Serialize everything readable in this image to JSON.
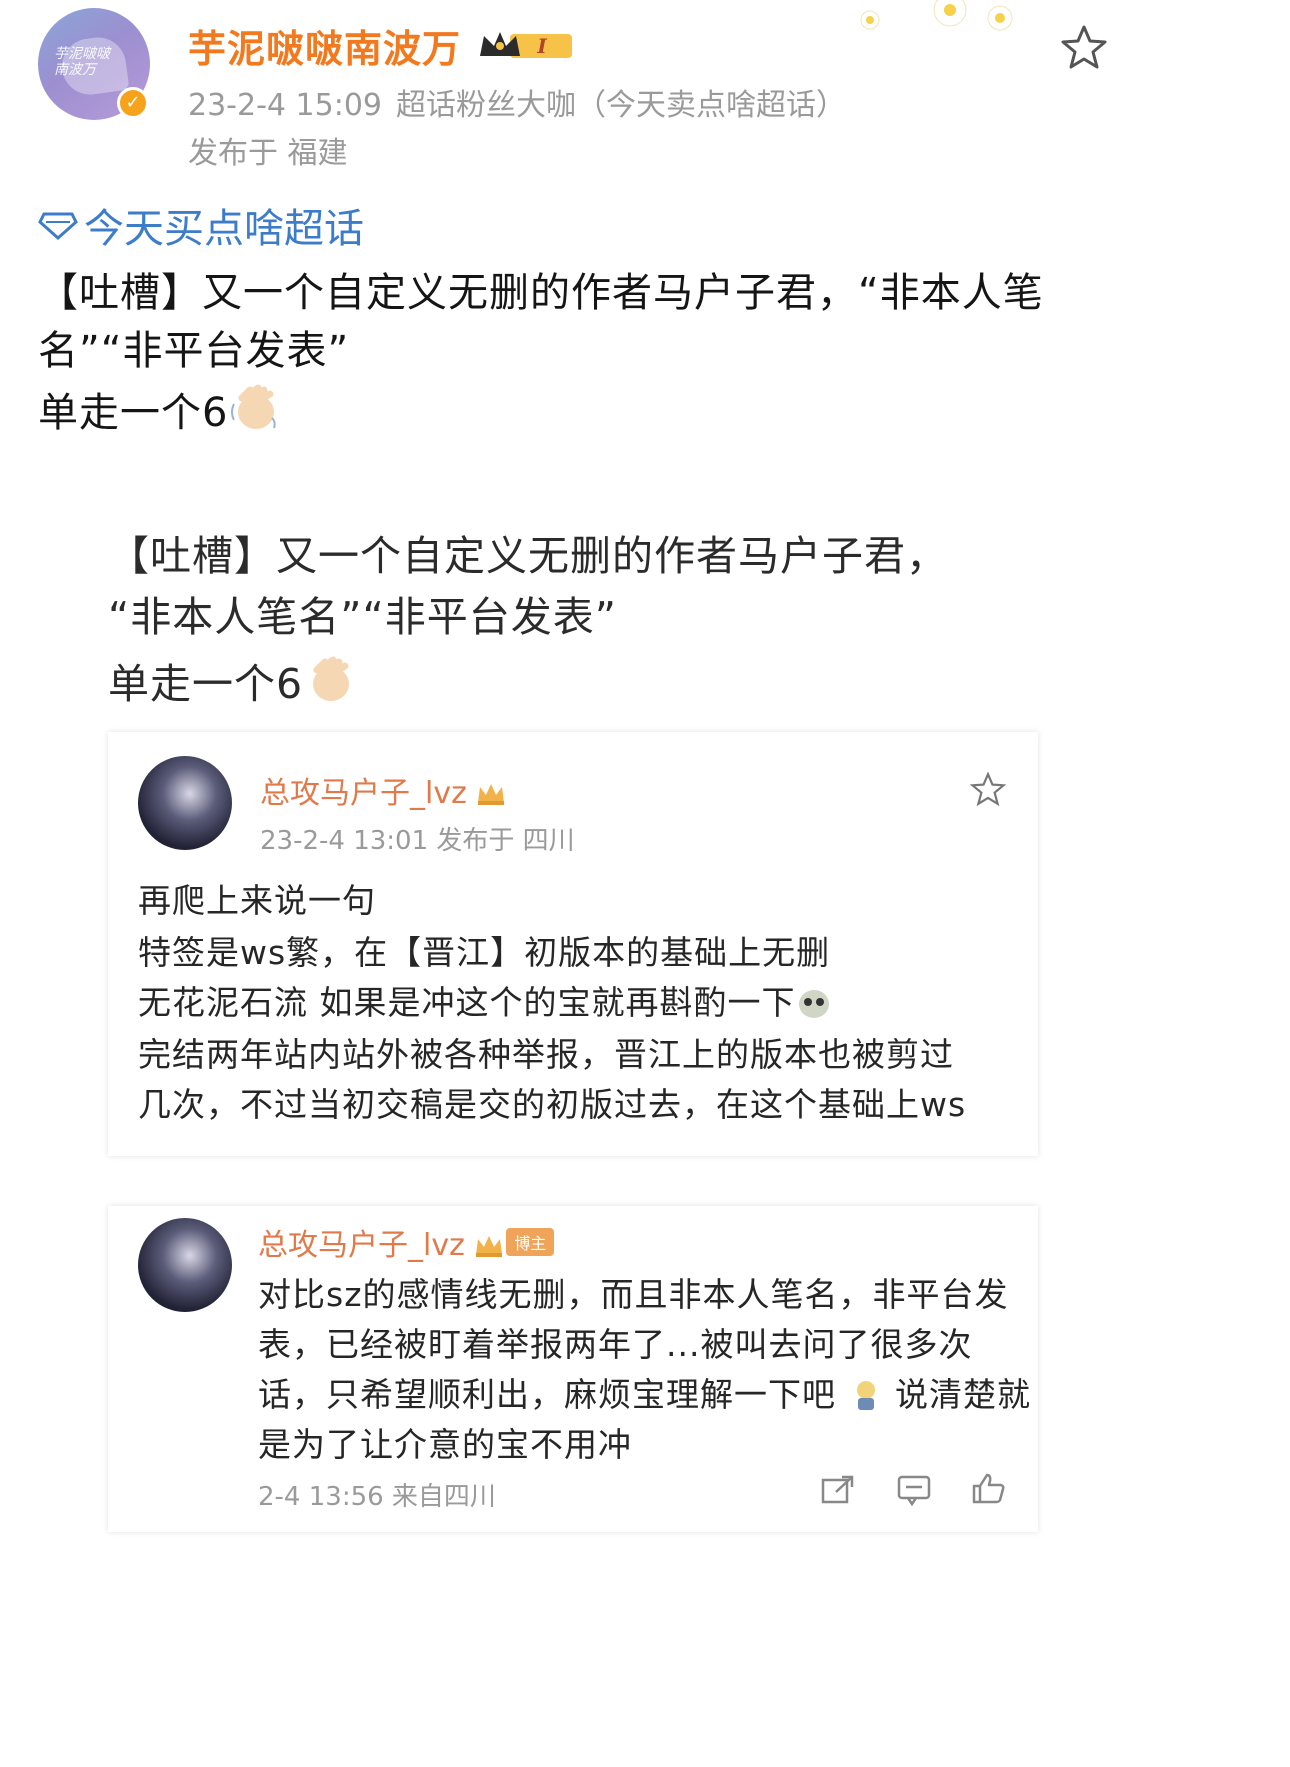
{
  "post": {
    "author": "芋泥啵啵南波万",
    "level_badge": "I",
    "timestamp": "23-2-4 15:09",
    "source": "超话粉丝大咖（今天卖点啥超话）",
    "location": "发布于 福建",
    "topic": "今天买点啥超话",
    "lines": [
      "【吐槽】又一个自定义无删的作者马户子君，“非本人笔",
      "名”“非平台发表”",
      "单走一个6"
    ]
  },
  "image": {
    "lines": [
      "【吐槽】又一个自定义无删的作者马户子君，",
      "“非本人笔名”“非平台发表”",
      "单走一个6"
    ],
    "card1": {
      "author": "总攻马户子_lvz",
      "meta": "23-2-4 13:01  发布于 四川",
      "lines": [
        "再爬上来说一句",
        "特签是ws繁，在【晋江】初版本的基础上无删",
        "无花泥石流  如果是冲这个的宝就再斟酌一下",
        "完结两年站内站外被各种举报，晋江上的版本也被剪过",
        "几次，不过当初交稿是交的初版过去，在这个基础上ws"
      ]
    },
    "card2": {
      "author": "总攻马户子_lvz",
      "owner_tag": "博主",
      "lines": [
        "对比sz的感情线无删，而且非本人笔名，非平台发",
        "表，已经被盯着举报两年了...被叫去问了很多次",
        "话，只希望顺利出，麻烦宝理解一下吧",
        "说清楚就",
        "是为了让介意的宝不用冲"
      ],
      "footer": "2-4 13:56 来自四川"
    }
  },
  "colors": {
    "username": "#f2791e",
    "topic": "#3d7cc9",
    "meta": "#9a9a9a"
  },
  "icons": [
    "star-icon",
    "crown-icon",
    "verified-icon",
    "diamond-icon",
    "waving-hand-emoji",
    "share-icon",
    "comment-icon",
    "like-icon"
  ]
}
